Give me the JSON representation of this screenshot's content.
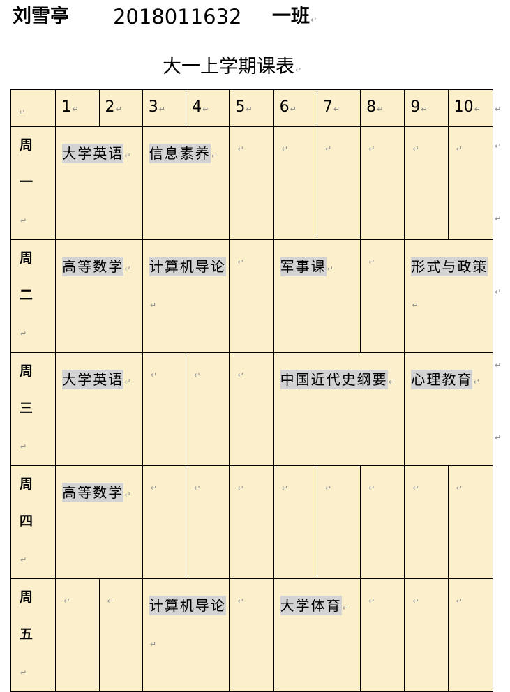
{
  "header": {
    "name": "刘雪亭",
    "student_id": "2018011632",
    "class_name": "一班"
  },
  "title": "大一上学期课表",
  "paragraph_mark": "↵",
  "periods": [
    "1",
    "2",
    "3",
    "4",
    "5",
    "6",
    "7",
    "8",
    "9",
    "10"
  ],
  "days": [
    {
      "label_top": "周",
      "label_bottom": "一",
      "c12": "大学英语",
      "c34": "信息素养"
    },
    {
      "label_top": "周",
      "label_bottom": "二",
      "c12": "高等数学",
      "c34": "计算机导论",
      "c67": "军事课",
      "c910": "形式与政策"
    },
    {
      "label_top": "周",
      "label_bottom": "三",
      "c12": "大学英语",
      "c67": "中国近代史纲要",
      "c910": "心理教育"
    },
    {
      "label_top": "周",
      "label_bottom": "四",
      "c12": "高等数学"
    },
    {
      "label_top": "周",
      "label_bottom": "五",
      "c34": "计算机导论",
      "c67": "大学体育"
    }
  ]
}
